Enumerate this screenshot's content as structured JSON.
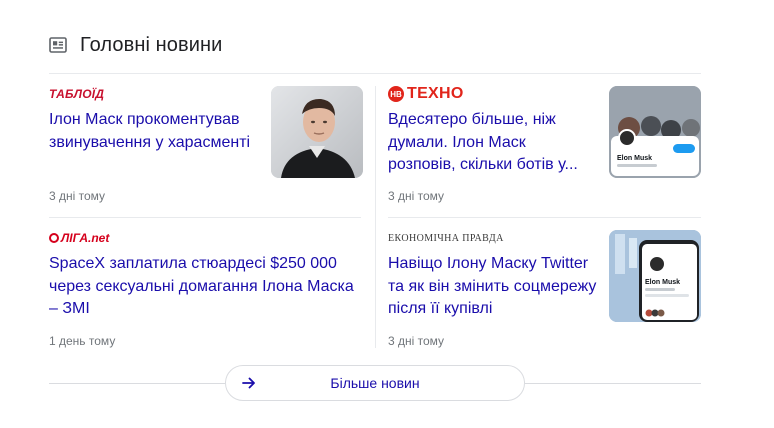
{
  "section": {
    "title": "Головні новини",
    "icon": "newspaper-icon"
  },
  "articles": [
    {
      "source": "ТАБЛОЇД",
      "source_color": "#c8102e",
      "headline": "Ілон Маск прокоментував звинувачення у харасменті",
      "time": "3 дні тому",
      "thumbnail": "elon-musk-portrait"
    },
    {
      "source": "ТЕХНО",
      "source_badge": "НВ",
      "source_color": "#e1251b",
      "headline": "Вдесятеро більше, ніж думали. Ілон Маск розповів, скільки ботів у...",
      "time": "3 дні тому",
      "thumbnail": "twitter-profile-phone"
    },
    {
      "source": "ЛІГА.net",
      "source_color": "#d5001c",
      "headline": "SpaceX заплатила стюардесі $250 000 через сексуальні домагання Ілона Маска – ЗМІ",
      "time": "1 день тому",
      "thumbnail": ""
    },
    {
      "source": "ЕКОНОМІЧНА ПРАВДА",
      "source_color": "#3a3a3a",
      "headline": "Навіщо Ілону Маску Twitter та як він змінить соцмережу після її купівлі",
      "time": "3 дні тому",
      "thumbnail": "twitter-profile-phone"
    }
  ],
  "thumb_text": {
    "profile_name": "Elon Musk"
  },
  "more_button": {
    "label": "Більше новин",
    "icon": "arrow-right-icon"
  },
  "colors": {
    "link": "#1a0dab",
    "meta": "#70757a",
    "divider": "#e8eaed"
  }
}
